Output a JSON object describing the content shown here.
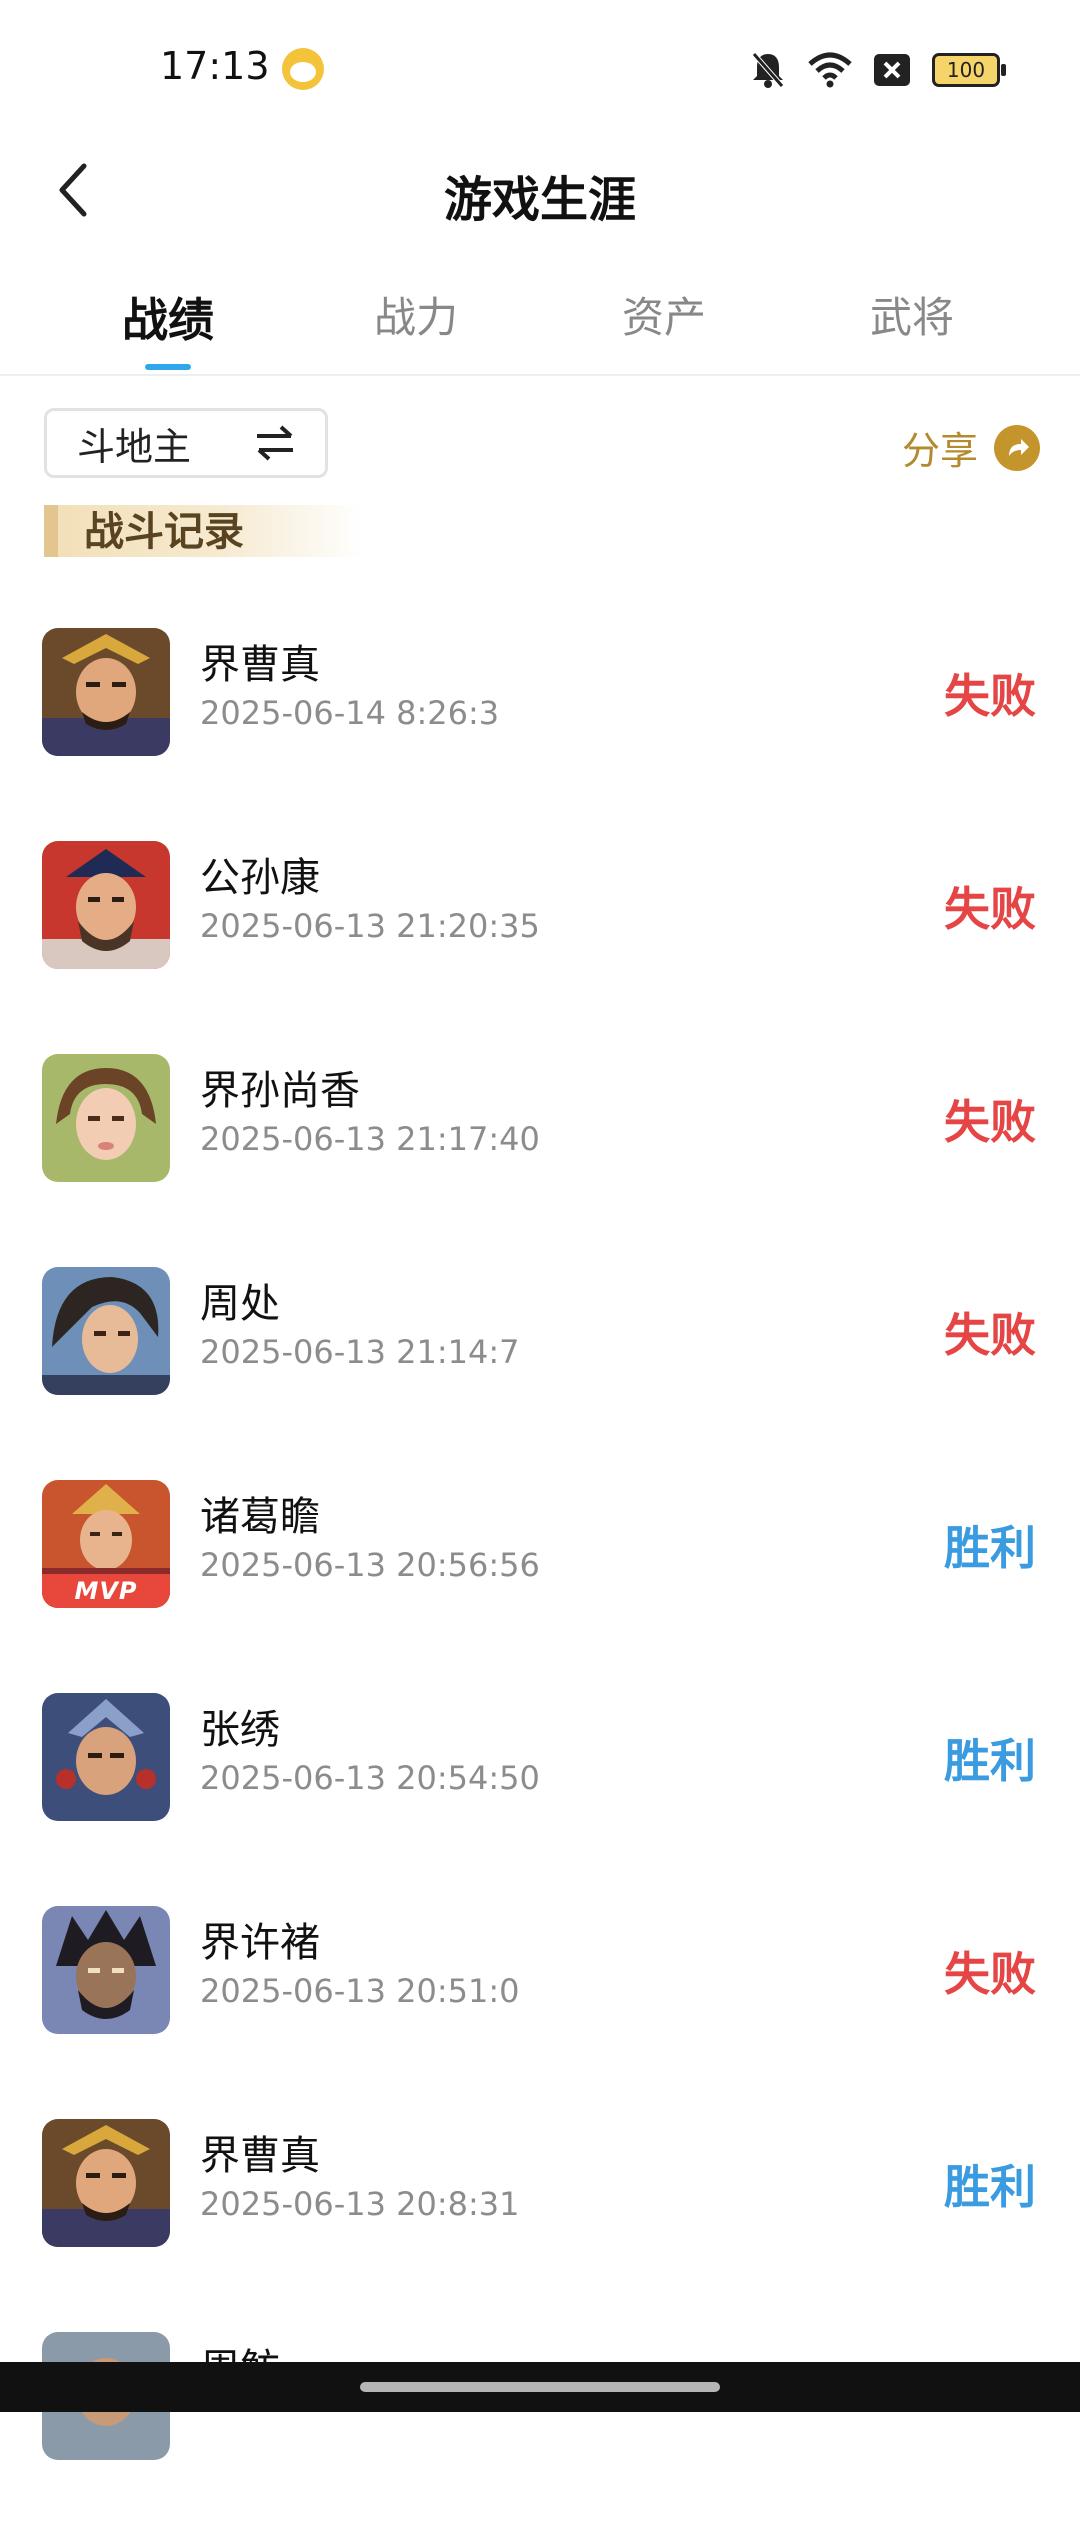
{
  "status_bar": {
    "time": "17:13",
    "app_icon": "panda-app-icon",
    "icons": [
      "bell-muted-icon",
      "wifi-icon",
      "close-box-icon",
      "battery-icon"
    ],
    "battery": "100"
  },
  "header": {
    "title": "游戏生涯",
    "back_icon": "chevron-left-icon"
  },
  "tabs": [
    {
      "label": "战绩",
      "active": true
    },
    {
      "label": "战力",
      "active": false
    },
    {
      "label": "资产",
      "active": false
    },
    {
      "label": "武将",
      "active": false
    }
  ],
  "filter": {
    "mode": "斗地主",
    "share_label": "分享"
  },
  "section": {
    "title": "战斗记录"
  },
  "records": [
    {
      "name": "界曹真",
      "time": "2025-06-14 8:26:3",
      "result": "失败",
      "outcome": "lose",
      "mvp": false
    },
    {
      "name": "公孙康",
      "time": "2025-06-13 21:20:35",
      "result": "失败",
      "outcome": "lose",
      "mvp": false
    },
    {
      "name": "界孙尚香",
      "time": "2025-06-13 21:17:40",
      "result": "失败",
      "outcome": "lose",
      "mvp": false
    },
    {
      "name": "周处",
      "time": "2025-06-13 21:14:7",
      "result": "失败",
      "outcome": "lose",
      "mvp": false
    },
    {
      "name": "诸葛瞻",
      "time": "2025-06-13 20:56:56",
      "result": "胜利",
      "outcome": "win",
      "mvp": true,
      "mvp_label": "MVP"
    },
    {
      "name": "张绣",
      "time": "2025-06-13 20:54:50",
      "result": "胜利",
      "outcome": "win",
      "mvp": false
    },
    {
      "name": "界许褚",
      "time": "2025-06-13 20:51:0",
      "result": "失败",
      "outcome": "lose",
      "mvp": false
    },
    {
      "name": "界曹真",
      "time": "2025-06-13 20:8:31",
      "result": "胜利",
      "outcome": "win",
      "mvp": false
    },
    {
      "name": "周鲂",
      "time": "",
      "result": "",
      "outcome": "",
      "mvp": false
    }
  ],
  "colors": {
    "accent": "#2ea8ec",
    "win": "#3a9be0",
    "lose": "#e64545",
    "share": "#b38a2e"
  }
}
